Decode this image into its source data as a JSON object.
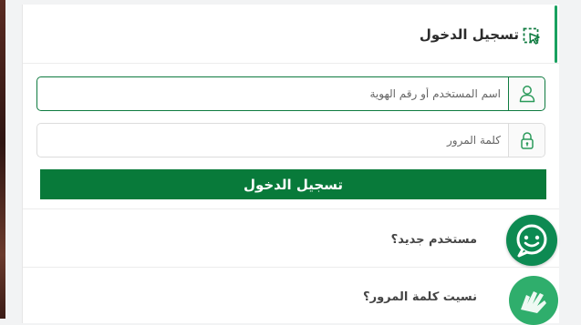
{
  "header": {
    "title": "تسجيل الدخول",
    "icon": "cursor-select-icon"
  },
  "username": {
    "placeholder": "اسم المستخدم أو رقم الهوية",
    "value": "",
    "icon": "user-icon"
  },
  "password": {
    "placeholder": "كلمة المرور",
    "value": "",
    "icon": "lock-icon"
  },
  "login_button": {
    "label": "تسجيل الدخول"
  },
  "links": {
    "new_user": "مستخدم جديد؟",
    "forgot_password": "نسيت كلمة المرور؟"
  },
  "widgets": {
    "chat": "chat-bot-icon",
    "sign_language": "sign-language-icon"
  },
  "colors": {
    "primary": "#087a3a",
    "accent": "#19a15f",
    "widget": "#0d8a52"
  }
}
